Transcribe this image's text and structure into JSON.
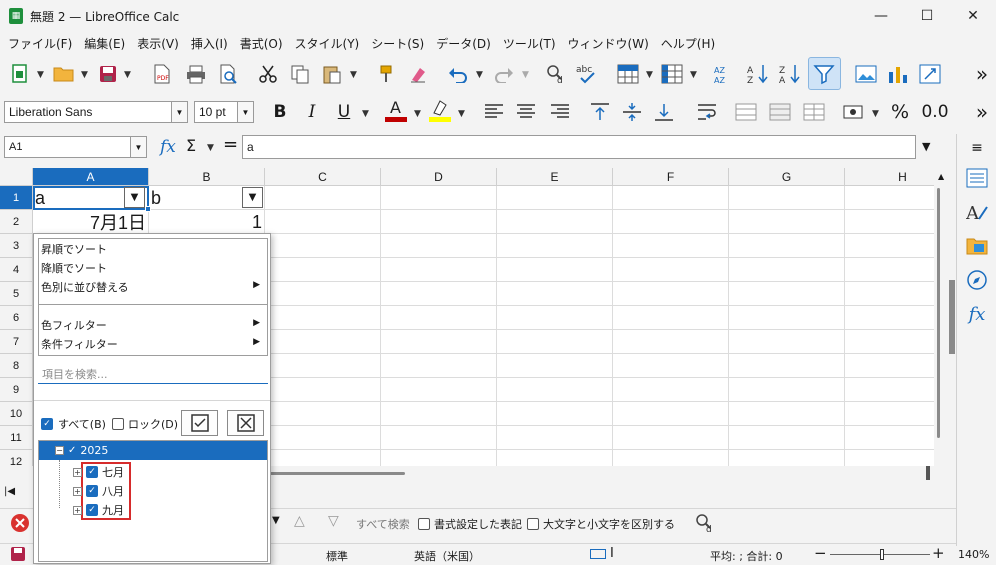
{
  "window": {
    "title": "無題 2 — LibreOffice Calc",
    "minimize": "—",
    "maximize": "☐",
    "close": "✕"
  },
  "menu": [
    "ファイル(F)",
    "編集(E)",
    "表示(V)",
    "挿入(I)",
    "書式(O)",
    "スタイル(Y)",
    "シート(S)",
    "データ(D)",
    "ツール(T)",
    "ウィンドウ(W)",
    "ヘルプ(H)"
  ],
  "format": {
    "font_name": "Liberation Sans",
    "font_size": "10 pt",
    "bold": "B",
    "italic": "I",
    "underline": "U",
    "percent": "%",
    "decimal": "0.0",
    "font_color": "#c00000",
    "highlight_color": "#ffff00"
  },
  "formula": {
    "name_box": "A1",
    "fx": "fx",
    "sum": "Σ",
    "equals": "=",
    "content": "a"
  },
  "grid": {
    "columns": [
      "A",
      "B",
      "C",
      "D",
      "E",
      "F",
      "G",
      "H"
    ],
    "rows": [
      "1",
      "2",
      "3",
      "4",
      "5",
      "6",
      "7",
      "8",
      "9",
      "10",
      "11",
      "12"
    ],
    "cells": {
      "A1": "a",
      "B1": "b",
      "A2": "7月1日",
      "B2": "1"
    }
  },
  "autofilter": {
    "sort_asc": "昇順でソート",
    "sort_desc": "降順でソート",
    "sort_by_color": "色別に並び替える",
    "color_filter": "色フィルター",
    "standard_filter": "条件フィルター",
    "search_placeholder": "項目を検索...",
    "all_label": "すべて(B)",
    "lock_label": "ロック(D)",
    "tree": [
      {
        "label": "2025",
        "checked": true,
        "expanded": true
      },
      {
        "label": "七月",
        "checked": true
      },
      {
        "label": "八月",
        "checked": true
      },
      {
        "label": "九月",
        "checked": true
      }
    ]
  },
  "findbar": {
    "find_all": "すべて検索",
    "formatted_display": "書式設定した表記",
    "match_case": "大文字と小文字を区別する"
  },
  "status": {
    "page_style": "標準",
    "language": "英語（米国）",
    "sum_text": "平均: ; 合計: 0",
    "zoom": "140%"
  }
}
